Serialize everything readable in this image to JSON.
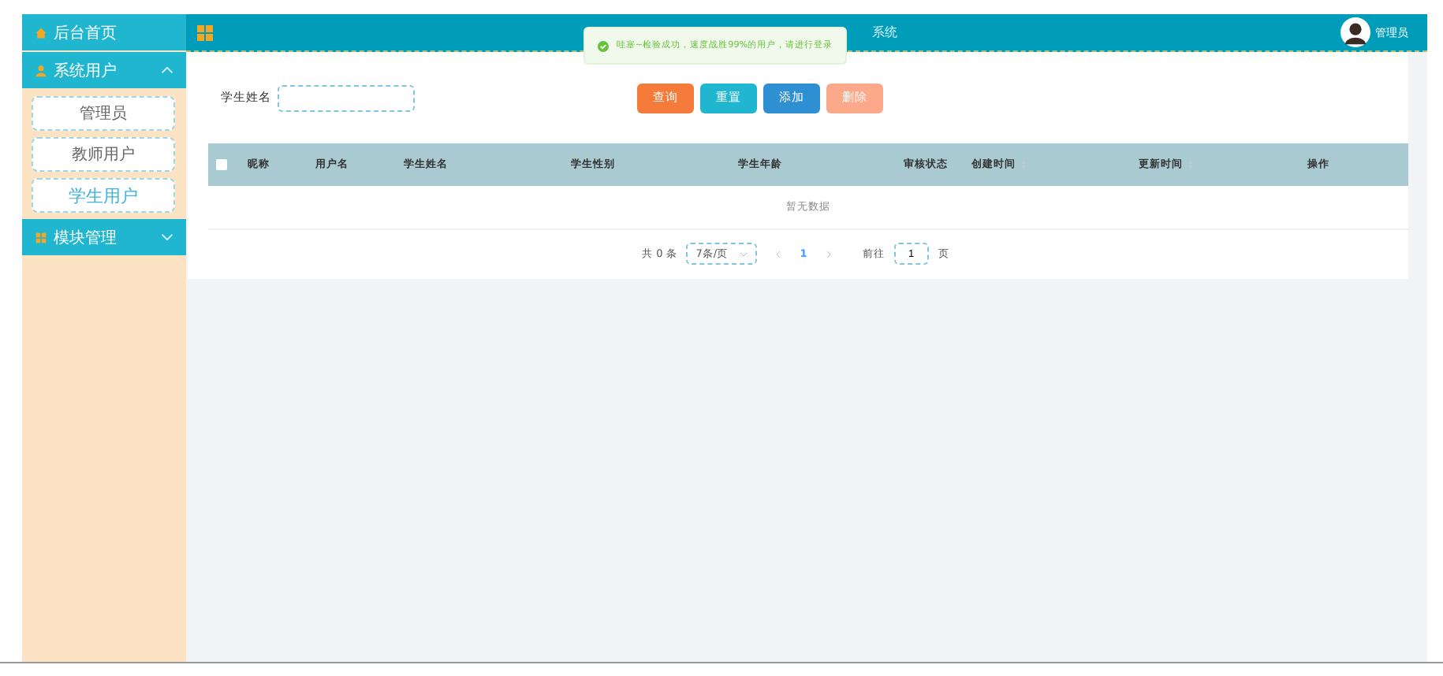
{
  "sidebar": {
    "items": [
      {
        "label": "后台首页"
      },
      {
        "label": "系统用户",
        "expanded": true,
        "children": [
          {
            "label": "管理员",
            "selected": false
          },
          {
            "label": "教师用户",
            "selected": false
          },
          {
            "label": "学生用户",
            "selected": true
          }
        ]
      },
      {
        "label": "模块管理",
        "expanded": false
      }
    ]
  },
  "header": {
    "title": "系统",
    "user": "管理员"
  },
  "toast": {
    "message": "哇塞~检验成功，速度战胜99%的用户，请进行登录"
  },
  "search": {
    "label": "学生姓名"
  },
  "buttons": [
    {
      "label": "查询",
      "kind": "search"
    },
    {
      "label": "重置",
      "kind": "reset"
    },
    {
      "label": "添加",
      "kind": "add"
    },
    {
      "label": "删除",
      "kind": "delete",
      "disabled": true
    }
  ],
  "table": {
    "all_checked": false,
    "columns": [
      {
        "label": "昵称",
        "sortable": false
      },
      {
        "label": "用户名",
        "sortable": false
      },
      {
        "label": "学生姓名",
        "sortable": false
      },
      {
        "label": "学生性别",
        "sortable": false
      },
      {
        "label": "学生年龄",
        "sortable": false
      },
      {
        "label": "审核状态",
        "sortable": false
      },
      {
        "label": "创建时间",
        "sortable": true
      },
      {
        "label": "更新时间",
        "sortable": true
      },
      {
        "label": "操作",
        "sortable": false
      }
    ],
    "empty_text": "暂无数据"
  },
  "pagination": {
    "total": "共 0 条",
    "page_size": "7条/页",
    "pages": [
      {
        "label": "1",
        "selected": true
      }
    ],
    "goto_label": "前往",
    "goto_value": "1",
    "goto_suffix": "页"
  }
}
